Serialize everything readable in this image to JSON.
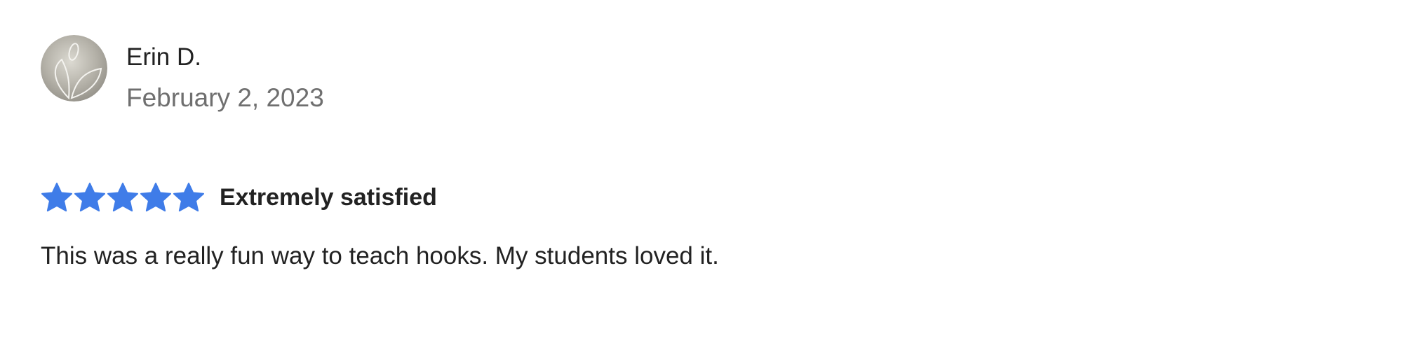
{
  "review": {
    "reviewer_name": "Erin D.",
    "date": "February 2, 2023",
    "avatar_icon": "heart-leaf-logo-icon",
    "rating": 5,
    "rating_max": 5,
    "rating_label": "Extremely satisfied",
    "star_icon": "star-icon",
    "body": "This was a really fun way to teach hooks. My students loved it."
  },
  "colors": {
    "star": "#3f7ce8",
    "text": "#222222",
    "muted": "#6f6f6f",
    "background": "#ffffff"
  }
}
